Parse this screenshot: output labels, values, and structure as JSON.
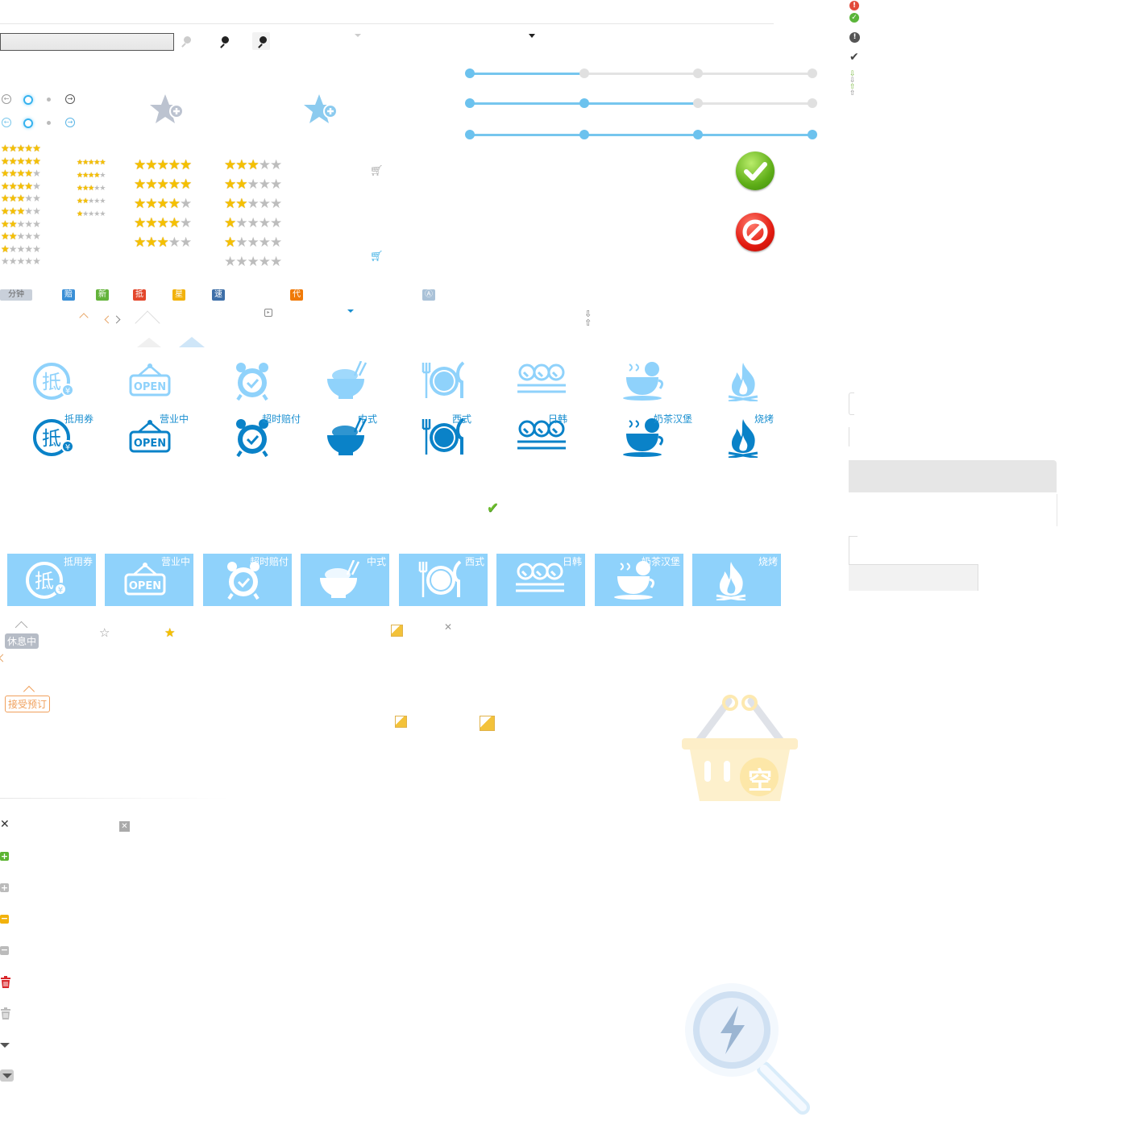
{
  "tags": {
    "minutes": "分钟",
    "compensate": "赔",
    "new": "新",
    "deduct": "抵",
    "star": "星",
    "fast": "速",
    "proxy": "代",
    "vote": "Ⓐ"
  },
  "categories": [
    {
      "label": "抵用券",
      "icon": "voucher-icon"
    },
    {
      "label": "营业中",
      "icon": "open-sign-icon"
    },
    {
      "label": "超时赔付",
      "icon": "alarm-clock-icon"
    },
    {
      "label": "中式",
      "icon": "rice-bowl-icon"
    },
    {
      "label": "西式",
      "icon": "plate-cutlery-icon"
    },
    {
      "label": "日韩",
      "icon": "sushi-icon"
    },
    {
      "label": "奶茶汉堡",
      "icon": "tea-cup-icon"
    },
    {
      "label": "烧烤",
      "icon": "flame-icon"
    }
  ],
  "open_sign": "OPEN",
  "voucher_char": "抵",
  "status_signs": {
    "resting": "休息中",
    "accept_booking": "接受预订"
  },
  "empty_basket_char": "空",
  "colors": {
    "light_blue": "#8fd2fb",
    "dark_blue": "#0a82c8",
    "green": "#6cbc2c",
    "red": "#e03428",
    "star_yellow": "#f5c000"
  },
  "sliders": [
    {
      "level": 0.33
    },
    {
      "level": 0.66
    },
    {
      "level": 1.0
    }
  ]
}
